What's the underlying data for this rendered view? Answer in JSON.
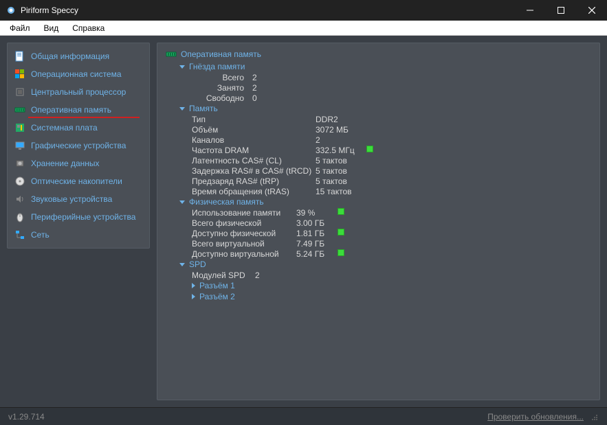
{
  "window": {
    "title": "Piriform Speccy"
  },
  "menubar": {
    "file": "Файл",
    "view": "Вид",
    "help": "Справка"
  },
  "sidebar": {
    "items": [
      {
        "label": "Общая информация"
      },
      {
        "label": "Операционная система"
      },
      {
        "label": "Центральный процессор"
      },
      {
        "label": "Оперативная память",
        "selected": true
      },
      {
        "label": "Системная плата"
      },
      {
        "label": "Графические устройства"
      },
      {
        "label": "Хранение данных"
      },
      {
        "label": "Оптические накопители"
      },
      {
        "label": "Звуковые устройства"
      },
      {
        "label": "Периферийные устройства"
      },
      {
        "label": "Сеть"
      }
    ]
  },
  "content": {
    "header": "Оперативная память",
    "sections": {
      "slots": {
        "title": "Гнёзда памяти",
        "rows": [
          {
            "label": "Всего",
            "value": "2"
          },
          {
            "label": "Занято",
            "value": "2"
          },
          {
            "label": "Свободно",
            "value": "0"
          }
        ]
      },
      "memory": {
        "title": "Память",
        "rows": [
          {
            "label": "Тип",
            "value": "DDR2"
          },
          {
            "label": "Объём",
            "value": "3072 МБ"
          },
          {
            "label": "Каналов",
            "value": "2"
          },
          {
            "label": "Частота DRAM",
            "value": "332.5 МГц",
            "status": true
          },
          {
            "label": "Латентность CAS# (CL)",
            "value": "5 тактов"
          },
          {
            "label": "Задержка RAS# в CAS# (tRCD)",
            "value": "5 тактов"
          },
          {
            "label": "Предзаряд RAS# (tRP)",
            "value": "5 тактов"
          },
          {
            "label": "Время обращения (tRAS)",
            "value": "15 тактов"
          }
        ]
      },
      "physical": {
        "title": "Физическая память",
        "rows": [
          {
            "label": "Использование памяти",
            "value": "39 %",
            "status": true
          },
          {
            "label": "Всего физической",
            "value": "3.00 ГБ"
          },
          {
            "label": "Доступно физической",
            "value": "1.81 ГБ",
            "status": true
          },
          {
            "label": "Всего виртуальной",
            "value": "7.49 ГБ"
          },
          {
            "label": "Доступно виртуальной",
            "value": "5.24 ГБ",
            "status": true
          }
        ]
      },
      "spd": {
        "title": "SPD",
        "modules_label": "Модулей SPD",
        "modules_value": "2",
        "slots": [
          {
            "label": "Разъём 1"
          },
          {
            "label": "Разъём 2"
          }
        ]
      }
    }
  },
  "statusbar": {
    "version": "v1.29.714",
    "update_link": "Проверить обновления..."
  }
}
